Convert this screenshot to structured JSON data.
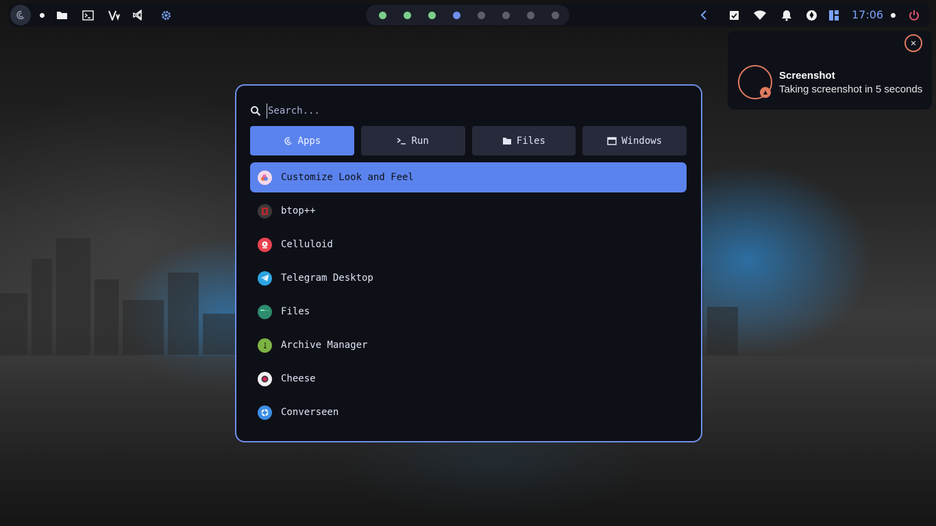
{
  "topbar": {
    "left_icons": [
      "debian-swirl-icon",
      "dot-indicator-icon",
      "folder-icon",
      "terminal-icon",
      "vim-icon",
      "vscode-icon",
      "settings-gear-icon"
    ],
    "workspaces": [
      {
        "color": "#7ccf8a"
      },
      {
        "color": "#7ccf8a"
      },
      {
        "color": "#7ccf8a"
      },
      {
        "color": "#6f8fe8"
      },
      {
        "color": "#5d5f68"
      },
      {
        "color": "#5d5f68"
      },
      {
        "color": "#5d5f68"
      },
      {
        "color": "#5d5f68"
      }
    ],
    "right_icons": [
      "chevron-left-icon",
      "clipboard-check-icon",
      "wifi-icon",
      "bell-icon",
      "shutter-icon",
      "layout-icon"
    ],
    "clock": "17:06",
    "power_icon": "power-icon"
  },
  "notification": {
    "title": "Screenshot",
    "body": "Taking screenshot in 5 seconds",
    "close_icon": "close-icon",
    "app_icon": "screenshot-icon"
  },
  "launcher": {
    "search": {
      "placeholder": "Search...",
      "value": ""
    },
    "tabs": [
      {
        "label": "Apps",
        "icon": "debian-swirl-icon",
        "active": true
      },
      {
        "label": "Run",
        "icon": "prompt-icon",
        "active": false
      },
      {
        "label": "Files",
        "icon": "folder-icon",
        "active": false
      },
      {
        "label": "Windows",
        "icon": "window-icon",
        "active": false
      }
    ],
    "apps": [
      {
        "label": "Customize Look and Feel",
        "icon": "appearance-icon",
        "color": "#f4d9e8"
      },
      {
        "label": "btop++",
        "icon": "btop-icon",
        "color": "#3a3a3a"
      },
      {
        "label": "Celluloid",
        "icon": "celluloid-icon",
        "color": "#e8424e"
      },
      {
        "label": "Telegram Desktop",
        "icon": "telegram-icon",
        "color": "#2ca5e0"
      },
      {
        "label": "Files",
        "icon": "files-icon",
        "color": "#2e8b6d"
      },
      {
        "label": "Archive Manager",
        "icon": "archive-icon",
        "color": "#7cb342"
      },
      {
        "label": "Cheese",
        "icon": "cheese-icon",
        "color": "#f2f2f2"
      },
      {
        "label": "Converseen",
        "icon": "converseen-icon",
        "color": "#3d8ee6"
      }
    ],
    "accent": "#5b83ee",
    "border": "#6f8fe8"
  }
}
